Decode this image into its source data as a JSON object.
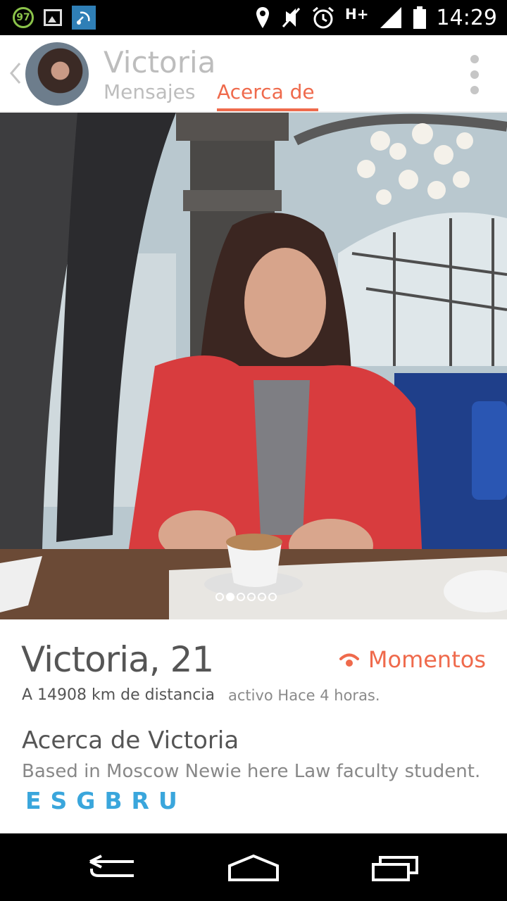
{
  "status_bar": {
    "battery_badge": "97",
    "network_type": "H+",
    "time": "14:29"
  },
  "header": {
    "name": "Victoria",
    "tabs": [
      {
        "label": "Mensajes",
        "active": false
      },
      {
        "label": "Acerca de",
        "active": true
      }
    ]
  },
  "photo": {
    "page_count": 6,
    "active_page": 2
  },
  "profile": {
    "name": "Victoria",
    "age": "21",
    "separator": ",",
    "momentos_label": "Momentos",
    "distance": "A 14908 km de distancia",
    "activity": "activo Hace 4 horas.",
    "about_heading": "Acerca de Victoria",
    "bio": "Based in Moscow Newie here Law faculty student.",
    "bio_code": "ESGBRU"
  },
  "colors": {
    "accent": "#ef6a4c",
    "bio_code": "#3aa6dc",
    "inactive_text": "#bdbdbd"
  }
}
